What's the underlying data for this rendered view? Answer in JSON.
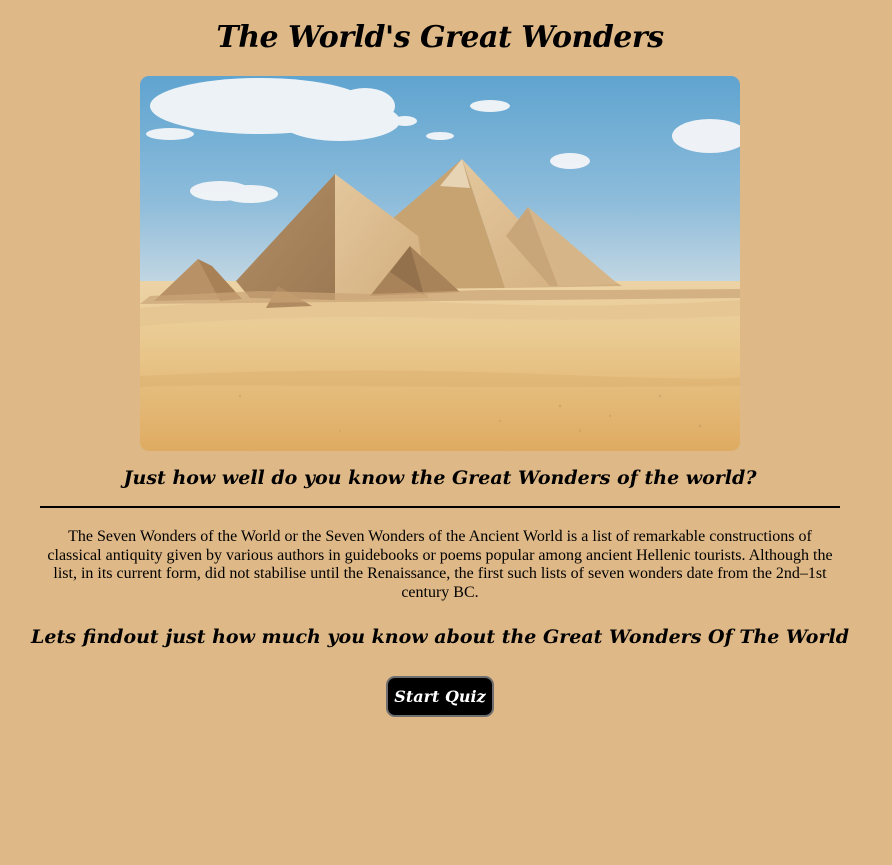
{
  "header": {
    "title": "The World's Great Wonders"
  },
  "hero": {
    "alt": "Pyramids of Giza in the desert"
  },
  "intro": {
    "question": "Just how well do you know the Great Wonders of the world?",
    "description": "The Seven Wonders of the World or the Seven Wonders of the Ancient World is a list of remarkable constructions of classical antiquity given by various authors in guidebooks or poems popular among ancient Hellenic tourists. Although the list, in its current form, did not stabilise until the Renaissance, the first such lists of seven wonders date from the 2nd–1st century BC.",
    "call_to_action": "Lets findout just how much you know about the Great Wonders Of The World"
  },
  "actions": {
    "start_label": "Start Quiz"
  },
  "colors": {
    "background": "#deb887",
    "button_background": "#000000",
    "button_text": "#ffffff"
  }
}
